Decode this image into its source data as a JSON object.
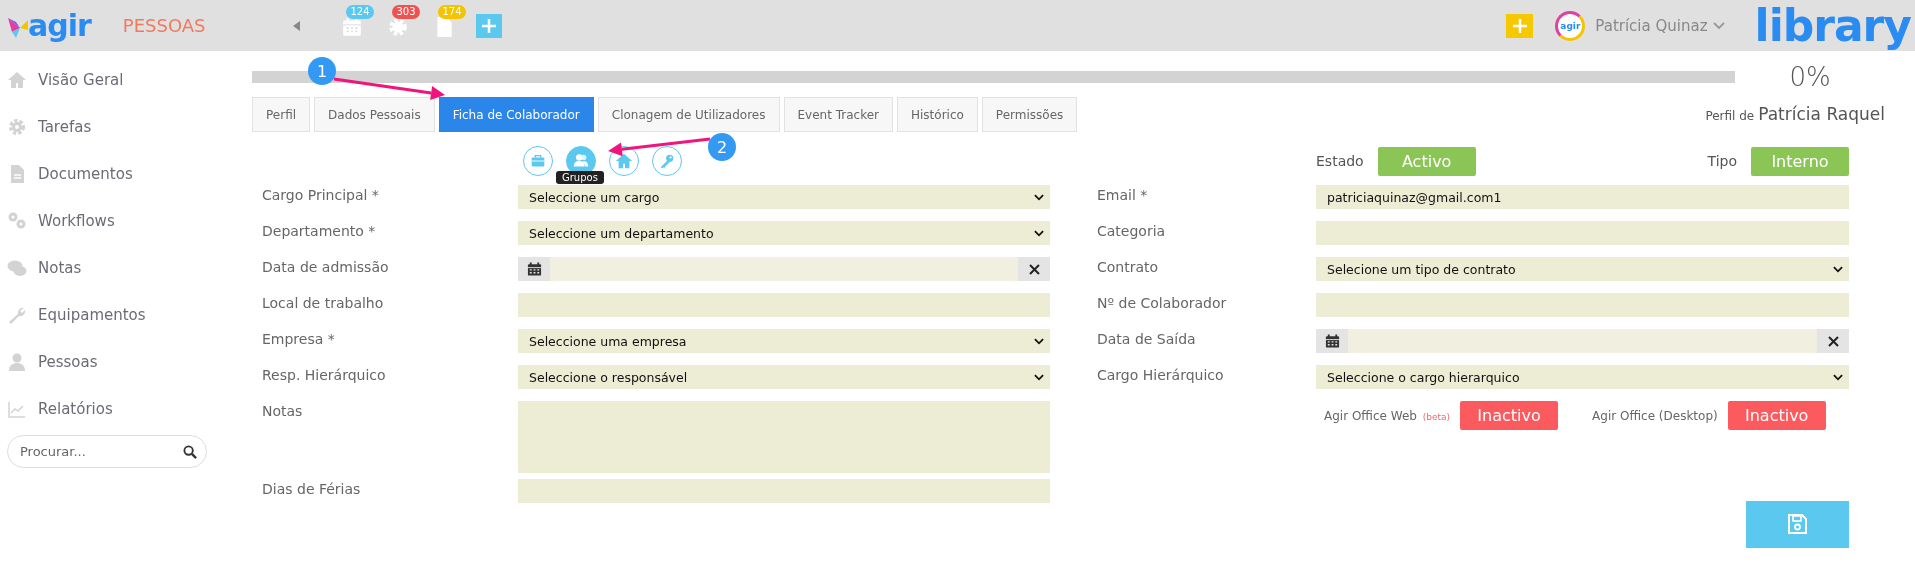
{
  "header": {
    "logo": "agir",
    "app": "PESSOAS",
    "badges": [
      {
        "kind": "calendar",
        "count": "124",
        "color": "#5bc8f0"
      },
      {
        "kind": "gear",
        "count": "303",
        "color": "#f05252"
      },
      {
        "kind": "document",
        "count": "174",
        "color": "#f5c400"
      }
    ],
    "avatar_text": "agir",
    "user": "Patrícia Quinaz",
    "brand": "library"
  },
  "sidebar": {
    "items": [
      {
        "label": "Visão Geral"
      },
      {
        "label": "Tarefas"
      },
      {
        "label": "Documentos"
      },
      {
        "label": "Workflows"
      },
      {
        "label": "Notas"
      },
      {
        "label": "Equipamentos"
      },
      {
        "label": "Pessoas"
      },
      {
        "label": "Relatórios"
      }
    ],
    "search": {
      "placeholder": "Procurar..."
    }
  },
  "progress": {
    "level": 0,
    "reading": "0%"
  },
  "tabs": [
    {
      "label": "Perfil",
      "selected": false
    },
    {
      "label": "Dados Pessoais",
      "selected": false
    },
    {
      "label": "Ficha de Colaborador",
      "selected": true
    },
    {
      "label": "Clonagem de Utilizadores",
      "selected": false
    },
    {
      "label": "Event Tracker",
      "selected": false
    },
    {
      "label": "Histórico",
      "selected": false
    },
    {
      "label": "Permissões",
      "selected": false
    }
  ],
  "profile": {
    "prefix": "Perfil de",
    "name": "Patrícia Raquel"
  },
  "section_icons": [
    {
      "selected": false
    },
    {
      "selected": true,
      "tooltip": "Grupos"
    },
    {
      "selected": false
    },
    {
      "selected": false
    }
  ],
  "status": [
    {
      "label": "Estado",
      "value": "Activo",
      "active": true
    },
    {
      "label": "Tipo",
      "value": "Interno",
      "active": true
    }
  ],
  "left_fields": [
    {
      "label": "Cargo Principal *",
      "kind": "select",
      "value": "Seleccione um cargo"
    },
    {
      "label": "Departamento *",
      "kind": "select",
      "value": "Seleccione um departamento"
    },
    {
      "label": "Data de admissão",
      "kind": "date"
    },
    {
      "label": "Local de trabalho",
      "kind": "text"
    },
    {
      "label": "Empresa *",
      "kind": "select",
      "value": "Seleccione uma empresa"
    },
    {
      "label": "Resp. Hierárquico",
      "kind": "select",
      "value": "Seleccione o responsável"
    },
    {
      "label": "Notas",
      "kind": "textarea"
    },
    {
      "label": "Dias de Férias",
      "kind": "text"
    }
  ],
  "right_fields": [
    {
      "label": "Email *",
      "kind": "text",
      "value": "patriciaquinaz@gmail.com1"
    },
    {
      "label": "Categoria",
      "kind": "text"
    },
    {
      "label": "Contrato",
      "kind": "select",
      "value": "Selecione um tipo de contrato"
    },
    {
      "label": "Nº de Colaborador",
      "kind": "text"
    },
    {
      "label": "Data de Saída",
      "kind": "date"
    },
    {
      "label": "Cargo Hierárquico",
      "kind": "select",
      "value": "Seleccione o cargo hierarquico"
    }
  ],
  "office": [
    {
      "label": "Agir Office Web",
      "note": "(beta)",
      "value": "Inactivo",
      "active": false
    },
    {
      "label": "Agir Office (Desktop)",
      "value": "Inactivo",
      "active": false
    }
  ],
  "annotations": [
    {
      "label": "1"
    },
    {
      "label": "2"
    }
  ]
}
